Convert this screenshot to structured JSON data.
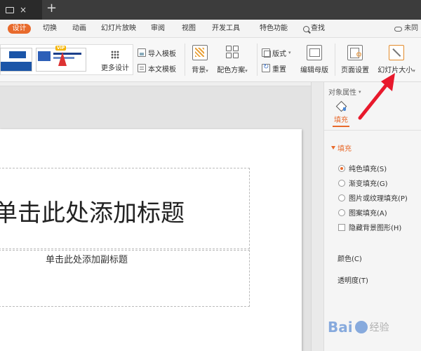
{
  "menu": {
    "design": "设计",
    "items": [
      "切换",
      "动画",
      "幻灯片放映",
      "审阅",
      "视图",
      "开发工具",
      "特色功能"
    ],
    "search": "查找",
    "cloud": "未同"
  },
  "ribbon": {
    "vip": "VIP",
    "more_design": "更多设计",
    "import_template": "导入模板",
    "text_template": "本文模板",
    "background": "背景",
    "color_scheme": "配色方案",
    "layout": "版式",
    "reset": "重置",
    "edit_master": "编辑母版",
    "page_setup": "页面设置",
    "slide_size": "幻灯片大小"
  },
  "slide": {
    "title_placeholder": "单击此处添加标题",
    "subtitle_placeholder": "单击此处添加副标题"
  },
  "panel": {
    "header": "对象属性",
    "tab_fill": "填充",
    "section_fill": "填充",
    "options": [
      {
        "label": "纯色填充(S)",
        "type": "radio",
        "selected": true
      },
      {
        "label": "渐变填充(G)",
        "type": "radio",
        "selected": false
      },
      {
        "label": "图片或纹理填充(P)",
        "type": "radio",
        "selected": false
      },
      {
        "label": "图案填充(A)",
        "type": "radio",
        "selected": false
      },
      {
        "label": "隐藏背景图形(H)",
        "type": "checkbox",
        "selected": false
      }
    ],
    "color_label": "颜色(C)",
    "transparency_label": "透明度(T)"
  },
  "watermark": {
    "brand": "Bai",
    "suffix": "经验"
  },
  "colors": {
    "accent": "#e86a2c",
    "titlebar": "#3c3c3c",
    "arrow": "#e8192c"
  }
}
